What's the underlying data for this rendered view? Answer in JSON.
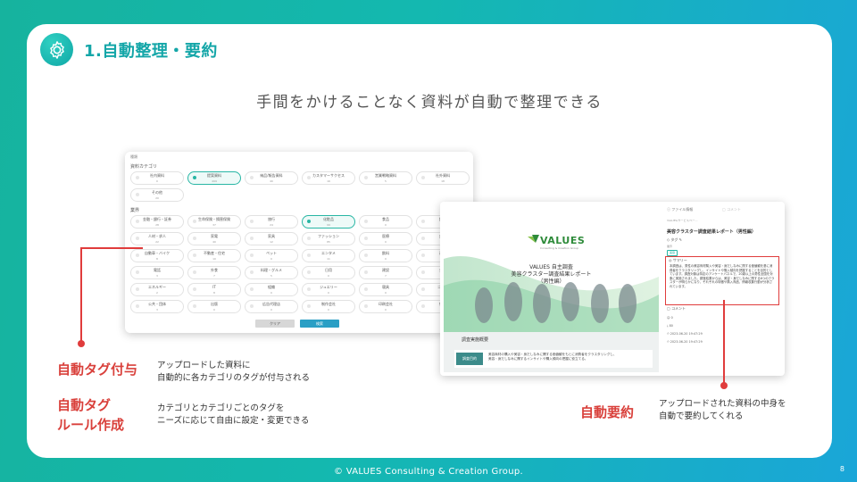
{
  "header": {
    "title": "1.自動整理・要約",
    "icon": "gear-icon"
  },
  "subtitle": "手間をかけることなく資料が自動で整理できる",
  "left_shot": {
    "top_label": "種類",
    "section1": "資料カテゴリ",
    "cats": [
      {
        "label": "社内資料",
        "count": "0",
        "on": false
      },
      {
        "label": "提案資料",
        "count": "499",
        "on": true
      },
      {
        "label": "納品/報告資料",
        "count": "40",
        "on": false
      },
      {
        "label": "カスタマーサクセス",
        "count": "16",
        "on": false
      },
      {
        "label": "営業戦略資料",
        "count": "5",
        "on": false
      },
      {
        "label": "社外資料",
        "count": "18",
        "on": false
      },
      {
        "label": "その他",
        "count": "20",
        "on": false
      }
    ],
    "section2": "業界",
    "industries": [
      {
        "label": "金融・銀行・証券",
        "count": "28",
        "on": false
      },
      {
        "label": "生命保険・損害保険",
        "count": "37",
        "on": false
      },
      {
        "label": "旅行",
        "count": "24",
        "on": false
      },
      {
        "label": "化粧品",
        "count": "99",
        "on": true
      },
      {
        "label": "食品",
        "count": "0",
        "on": false
      },
      {
        "label": "飲料",
        "count": "0",
        "on": false
      },
      {
        "label": "人材・求人",
        "count": "22",
        "on": false
      },
      {
        "label": "家電",
        "count": "40",
        "on": false
      },
      {
        "label": "家具",
        "count": "12",
        "on": false
      },
      {
        "label": "ファッション",
        "count": "85",
        "on": false
      },
      {
        "label": "医療",
        "count": "0",
        "on": false
      },
      {
        "label": "美容",
        "count": "0",
        "on": false
      },
      {
        "label": "自動車・バイク",
        "count": "8",
        "on": false
      },
      {
        "label": "不動産・住宅",
        "count": "10",
        "on": false
      },
      {
        "label": "ペット",
        "count": "0",
        "on": false
      },
      {
        "label": "エンタメ",
        "count": "11",
        "on": false
      },
      {
        "label": "飲料",
        "count": "0",
        "on": false
      },
      {
        "label": "通信",
        "count": "0",
        "on": false
      },
      {
        "label": "電話",
        "count": "3",
        "on": false
      },
      {
        "label": "外食",
        "count": "7",
        "on": false
      },
      {
        "label": "料理・グルメ",
        "count": "5",
        "on": false
      },
      {
        "label": "日用",
        "count": "0",
        "on": false
      },
      {
        "label": "建設",
        "count": "7",
        "on": false
      },
      {
        "label": "金融",
        "count": "0",
        "on": false
      },
      {
        "label": "エネルギー",
        "count": "2",
        "on": false
      },
      {
        "label": "IT",
        "count": "8",
        "on": false
      },
      {
        "label": "組織",
        "count": "0",
        "on": false
      },
      {
        "label": "ジュエリー",
        "count": "0",
        "on": false
      },
      {
        "label": "寝具",
        "count": "0",
        "on": false
      },
      {
        "label": "ゴルフ",
        "count": "0",
        "on": false
      },
      {
        "label": "公共・団体",
        "count": "3",
        "on": false
      },
      {
        "label": "出版",
        "count": "0",
        "on": false
      },
      {
        "label": "広告代理店",
        "count": "0",
        "on": false
      },
      {
        "label": "制作会社",
        "count": "0",
        "on": false
      },
      {
        "label": "印刷会社",
        "count": "0",
        "on": false
      },
      {
        "label": "教育",
        "count": "0",
        "on": false
      }
    ],
    "clear": "クリア",
    "search": "検索"
  },
  "right_shot": {
    "logo": "VALUES",
    "logo_sub": "Consulting & Creation Group",
    "doc_title1": "VALUES 自主調査",
    "doc_title2": "美容クラスター調査結果レポート",
    "doc_title3": "（男性編）",
    "band_title": "調査実施概要",
    "row_label": "調査目的",
    "row_text1": "美容商材の購入や美容・身だしなみに関する価値観をもとに消費者をクラスタリングし、",
    "row_text2": "美容・身だしなみに関するインサイトや購入傾向の把握に役立てる。",
    "tab1": "ファイル情報",
    "tab2": "コメント",
    "small1": "VALUES/サービス/ベー…",
    "file_title": "美容クラスター調査結果レポート（男性編）",
    "tag_label": "タグ",
    "tag_sub": "業界",
    "tag_value": "美容",
    "summary_label": "サマリー",
    "summary_text": "本調査は、男性の美容商材購入や美容・身だしなみに関する価値観を基に消費者をクラスタリングし、インサイトや購入傾向を把握することを目的としています。調査対象は特定のアンケートパネルで、20歳以上の男性全国を対象に実施されました。調査結果からは、美容・身だしなみに関する6つのクラスターが明らかになり、それぞれの特徴や購入商品、情報収集行動が分析されています。",
    "comment_label": "コメント",
    "meta1": "0",
    "meta2": "80",
    "meta3": "2023-06-20 19:47:29",
    "meta4": "2023-06-20 19:47:29"
  },
  "annotations": {
    "tag_auto": "自動タグ付与",
    "tag_auto_desc1": "アップロードした資料に",
    "tag_auto_desc2": "自動的に各カテゴリのタグが付与される",
    "tag_rule1": "自動タグ",
    "tag_rule2": "ルール作成",
    "tag_rule_desc1": "カテゴリとカテゴリごとのタグを",
    "tag_rule_desc2": "ニーズに応じて自由に設定・変更できる",
    "summary": "自動要約",
    "summary_desc1": "アップロードされた資料の中身を",
    "summary_desc2": "自動で要約してくれる"
  },
  "footer": "© VALUES Consulting  & Creation Group.",
  "page_number": "8",
  "colors": {
    "accent": "#14a6a8",
    "red": "#d9403b",
    "bg_start": "#16b39e",
    "bg_end": "#1aa6d8"
  }
}
